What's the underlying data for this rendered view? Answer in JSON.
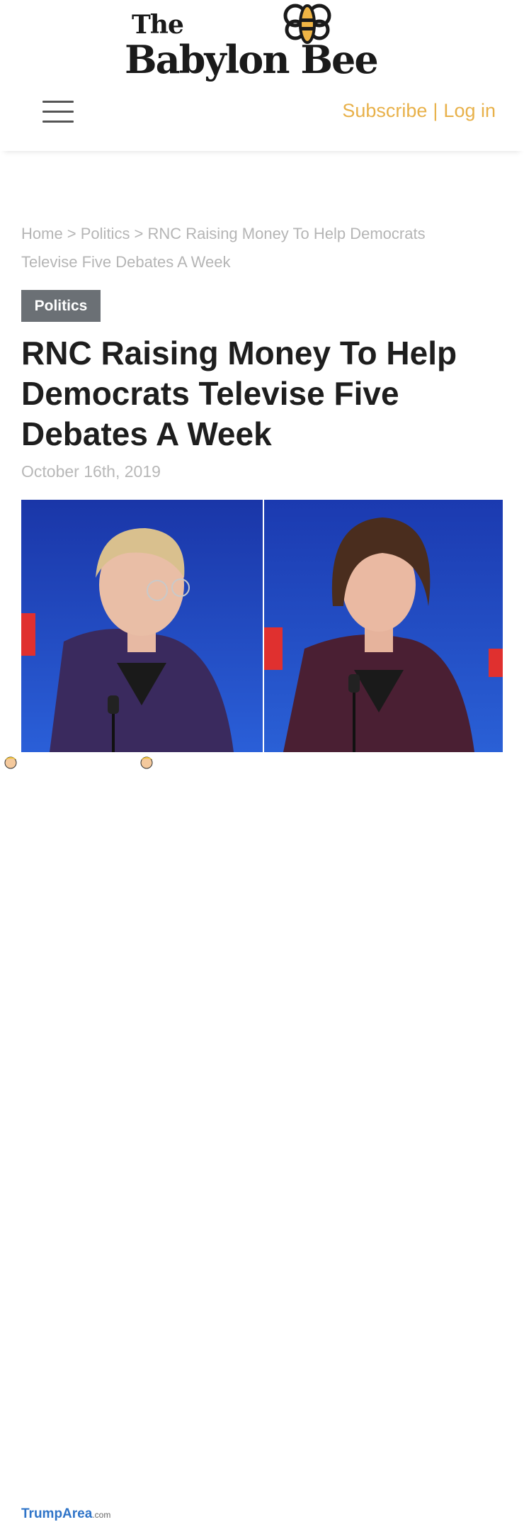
{
  "logo": {
    "line1": "The",
    "line2": "Babylon Bee"
  },
  "header": {
    "subscribe": "Subscribe",
    "separator": "|",
    "login": "Log in"
  },
  "breadcrumb": {
    "text": "Home > Politics > RNC Raising Money To Help Democrats Televise Five Debates A Week"
  },
  "article": {
    "category": "Politics",
    "title": "RNC Raising Money To Help Democrats Televise Five Debates A Week",
    "date": "October 16th, 2019"
  },
  "watermark": {
    "brand": "TrumpArea",
    "suffix": ".com"
  },
  "colors": {
    "accent": "#e8b14a",
    "badge": "#6b7075",
    "hero_bg": "#1d3fb0"
  },
  "icons": [
    "bee-logo-icon",
    "hamburger-menu-icon",
    "trump-face-icon"
  ]
}
